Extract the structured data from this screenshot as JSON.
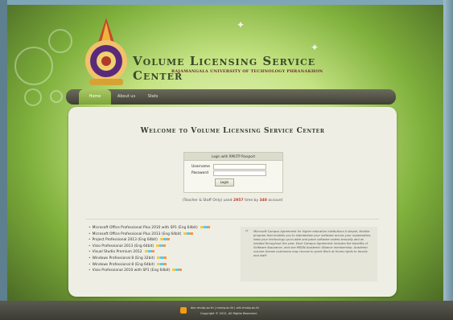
{
  "header": {
    "title": "Volume Licensing Service Center",
    "subtitle": "Rajamangala University of Technology Phranakhon"
  },
  "nav": {
    "items": [
      {
        "label": "Home"
      },
      {
        "label": "About us"
      },
      {
        "label": "Stats"
      }
    ]
  },
  "main": {
    "welcome": "Welcome to Volume Licensing Service Center",
    "login": {
      "heading": "Login with RMUTP Passport",
      "username_label": "Username",
      "password_label": "Password",
      "button_label": "Login",
      "username_value": "",
      "password_value": ""
    },
    "usage": {
      "prefix": "(Teacher & Staff Only) used",
      "used": "2957",
      "middle": "time   by",
      "by": "340",
      "suffix": "account"
    },
    "products": [
      "Microsoft Office Professional Plus 2010 with SP1 (Eng 64bit)",
      "Microsoft Office Professional Plus 2013 (Eng 64bit)",
      "Project Professional 2013 (Eng 64bit)",
      "Visio Professional 2013 (Eng 64bit)",
      "Visual Studio Premium 2012",
      "Windows Professional 8 (Eng 32bit)",
      "Windows Professional 8 (Eng 64bit)",
      "Visio Professional 2010 with SP1 (Eng 64bit)"
    ],
    "blurb": "Microsoft Campus Agreement for higher education institutions A simple, flexible program that enables you to standardize your software across your organization, keep your technology up-to-date and place software orders annually and as needed throughout the year. Each Campus Agreement includes the benefits of Software Assurance, and one MSDN Academic Alliance membership. Academic volume license customers may choose to grant Work at Home rights to faculty and staff."
  },
  "footer": {
    "links": "doc.rmutp.ac.th  |  rmutp.ac.th  |  arit.rmutp.ac.th",
    "copyright": "Copyright © 2012, All Rights Reserved."
  },
  "colors": {
    "accent_green": "#7ea43a",
    "usage_highlight": "#c0392b",
    "rss_orange": "#f39c12"
  }
}
